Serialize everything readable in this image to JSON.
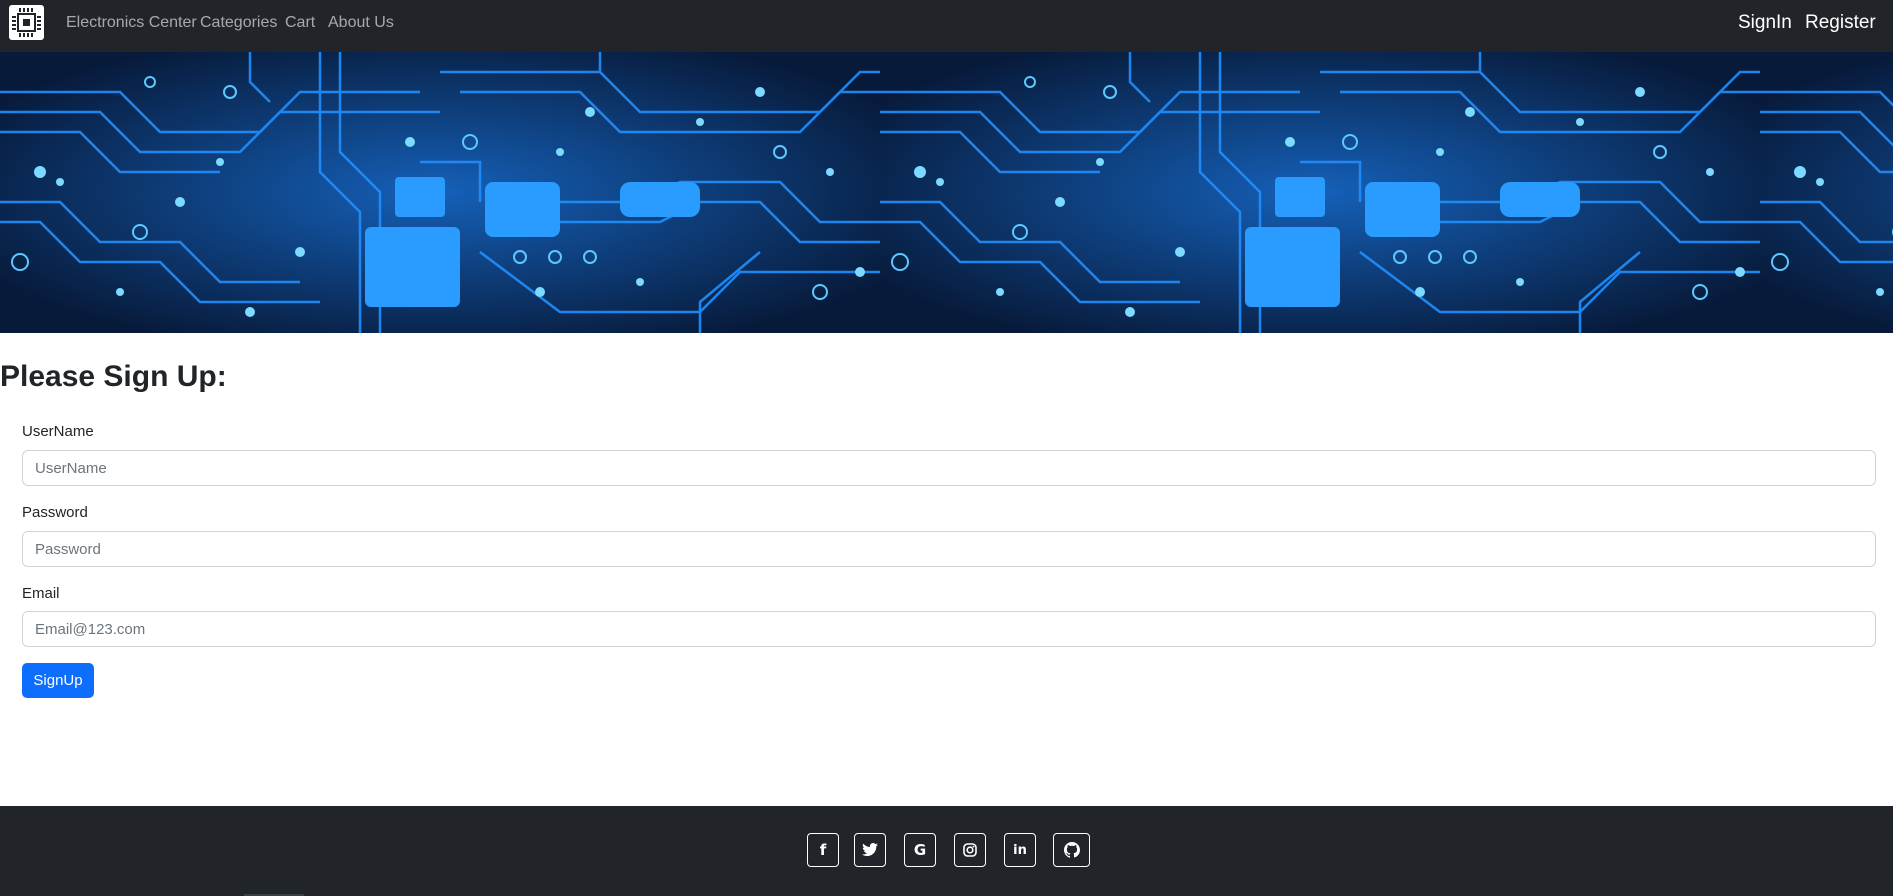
{
  "navbar": {
    "brand": "Electronics Center",
    "links": [
      "Categories",
      "Cart",
      "About Us"
    ],
    "right_links": [
      "SignIn",
      "Register"
    ]
  },
  "form": {
    "title": "Please Sign Up:",
    "fields": [
      {
        "label": "UserName",
        "placeholder": "UserName",
        "value": ""
      },
      {
        "label": "Password",
        "placeholder": "Password",
        "value": ""
      },
      {
        "label": "Email",
        "placeholder": "Email@123.com",
        "value": ""
      }
    ],
    "submit_label": "SignUp"
  },
  "footer": {
    "social_icons": [
      "facebook-icon",
      "twitter-icon",
      "google-icon",
      "instagram-icon",
      "linkedin-icon",
      "github-icon"
    ]
  },
  "colors": {
    "navbar_bg": "#212529",
    "primary_button": "#0d6efd",
    "hero_circuit": "#1e90ff"
  }
}
